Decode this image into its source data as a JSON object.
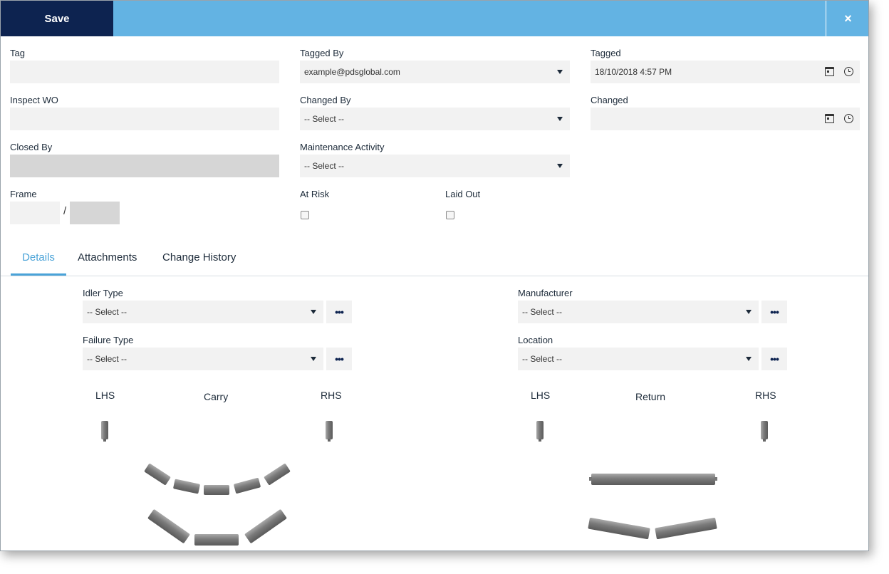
{
  "toolbar": {
    "save_label": "Save",
    "close_glyph": "×"
  },
  "form": {
    "tag": {
      "label": "Tag",
      "value": ""
    },
    "tagged_by": {
      "label": "Tagged By",
      "value": "example@pdsglobal.com"
    },
    "tagged": {
      "label": "Tagged",
      "value": "18/10/2018 4:57 PM"
    },
    "inspect_wo": {
      "label": "Inspect WO",
      "value": ""
    },
    "changed_by": {
      "label": "Changed By",
      "value": "-- Select --"
    },
    "changed": {
      "label": "Changed",
      "value": ""
    },
    "closed_by": {
      "label": "Closed By",
      "value": ""
    },
    "maintenance_activity": {
      "label": "Maintenance Activity",
      "value": "-- Select --"
    },
    "frame": {
      "label": "Frame",
      "separator": "/",
      "value_a": "",
      "value_b": ""
    },
    "at_risk": {
      "label": "At Risk",
      "checked": false
    },
    "laid_out": {
      "label": "Laid Out",
      "checked": false
    }
  },
  "tabs": [
    {
      "label": "Details",
      "active": true
    },
    {
      "label": "Attachments",
      "active": false
    },
    {
      "label": "Change History",
      "active": false
    }
  ],
  "details": {
    "idler_type": {
      "label": "Idler Type",
      "value": "-- Select --"
    },
    "failure_type": {
      "label": "Failure Type",
      "value": "-- Select --"
    },
    "manufacturer": {
      "label": "Manufacturer",
      "value": "-- Select --"
    },
    "location": {
      "label": "Location",
      "value": "-- Select --"
    },
    "more_glyph": "•••",
    "carry": {
      "title": "Carry",
      "lhs": "LHS",
      "rhs": "RHS"
    },
    "return": {
      "title": "Return",
      "lhs": "LHS",
      "rhs": "RHS"
    }
  },
  "icons": [
    "calendar-icon",
    "clock-icon",
    "chevron-down-icon",
    "more-icon",
    "close-icon"
  ],
  "colors": {
    "primary": "#0d2350",
    "accent": "#63b3e3",
    "tab_active": "#4aa3d8",
    "field_bg": "#f2f2f2",
    "roller": "#7a7a7a"
  }
}
